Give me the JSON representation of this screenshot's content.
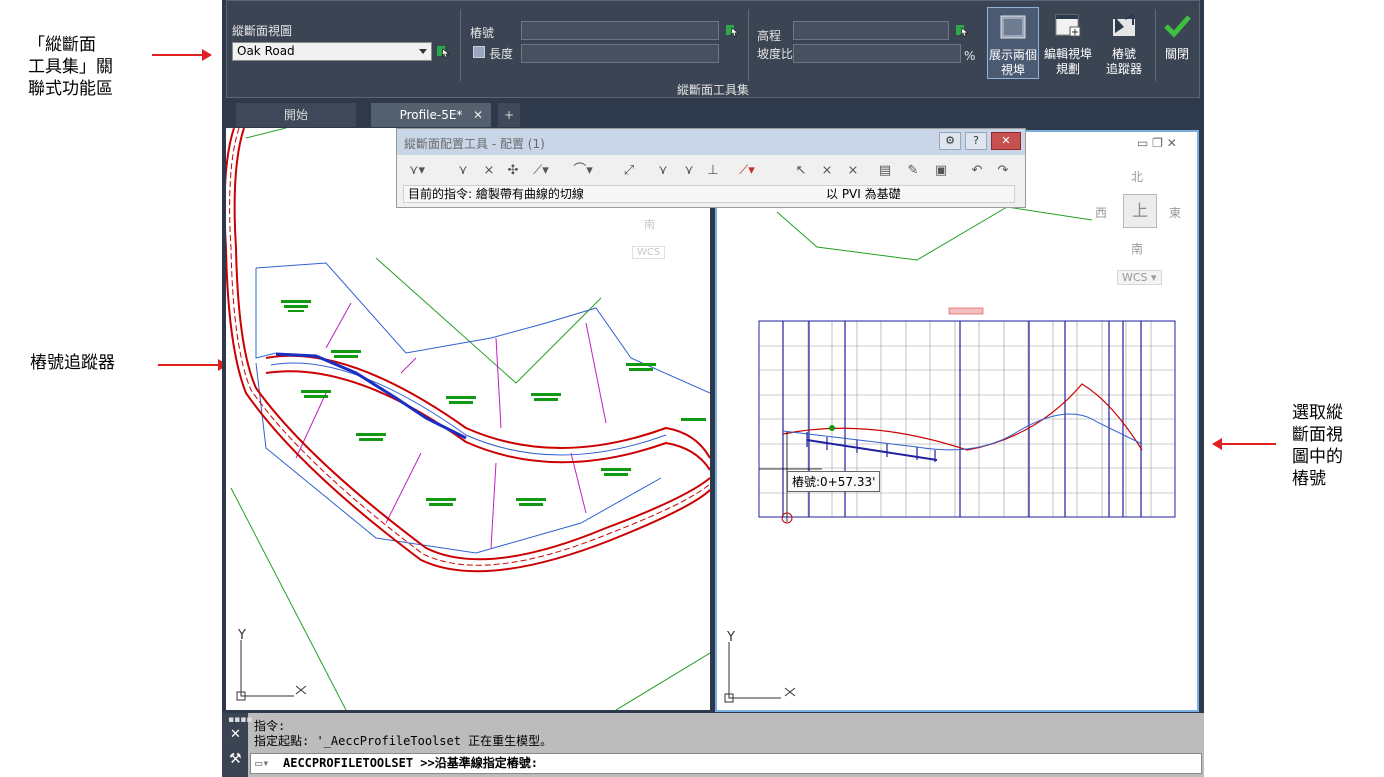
{
  "callouts": {
    "ribbon": "「縱斷面\n工具集」關\n聯式功能區",
    "station_tracker": "樁號追蹤器",
    "select_station": "選取縱\n斷面視\n圖中的\n樁號"
  },
  "ribbon": {
    "profile_view_label": "縱斷面視圖",
    "profile_view_value": "Oak Road",
    "station_label": "樁號",
    "length_label": "長度",
    "elevation_label": "高程",
    "grade_label": "坡度比",
    "percent": "%",
    "show_two_views": "展示兩個\n視埠",
    "edit_viewport": "編輯視埠\n規劃",
    "station_tracker": "樁號\n追蹤器",
    "close": "關閉",
    "panel_title": "縱斷面工具集"
  },
  "tabs": [
    {
      "label": "開始"
    },
    {
      "label": "Profile-5E*"
    }
  ],
  "layout_tools": {
    "title": "縱斷面配置工具 - 配置 (1)",
    "current_command": "目前的指令: 繪製帶有曲線的切線",
    "mode": "以 PVI 為基礎"
  },
  "viewcube": {
    "north": "北",
    "south": "南",
    "east": "東",
    "west": "西",
    "top": "上",
    "wcs": "WCS"
  },
  "ucs": {
    "y": "Y",
    "x": "X"
  },
  "profile": {
    "station_tooltip": "樁號:0+57.33'"
  },
  "command": {
    "history": [
      "指令:",
      "指定起點: '_AeccProfileToolset 正在重生模型。"
    ],
    "prompt": "AECCPROFILETOOLSET >>沿基準線指定樁號:"
  },
  "colors": {
    "accent": "#e02020",
    "alignment": "#cc0000",
    "parcel": "#3060d0",
    "green": "#119911",
    "magenta": "#c020c0"
  }
}
